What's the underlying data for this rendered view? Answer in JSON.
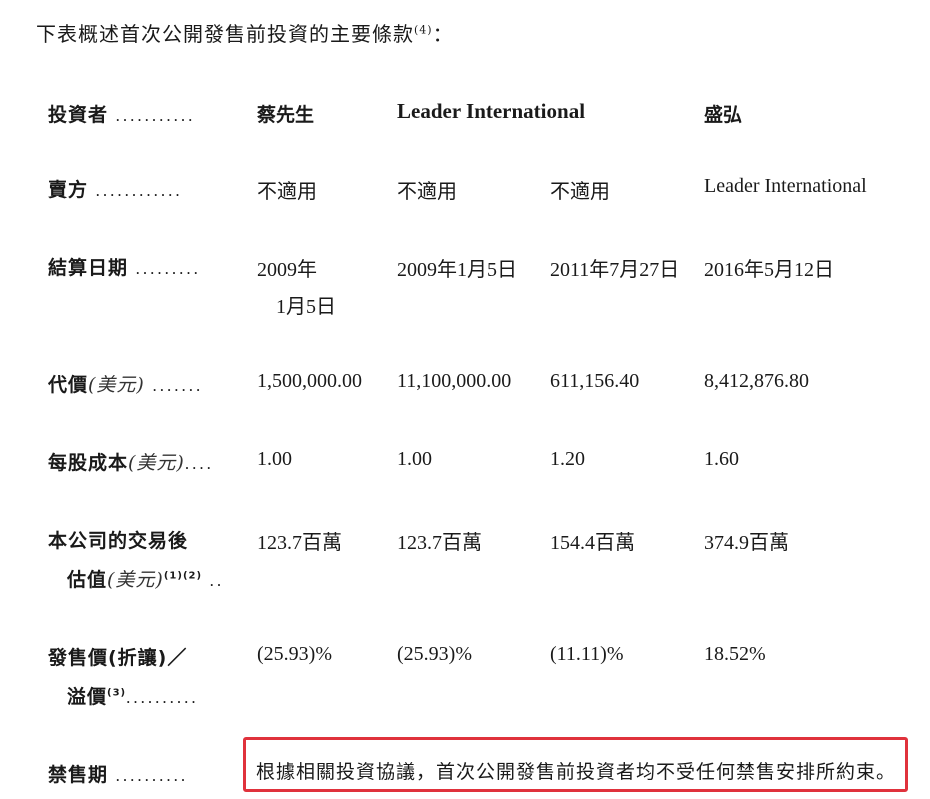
{
  "intro": {
    "text": "下表概述首次公開發售前投資的主要條款",
    "sup": "(4)",
    "tail": "："
  },
  "headers": {
    "investor_label": "投資者",
    "investor_dots": "...........",
    "col1": "蔡先生",
    "col2": "Leader International",
    "col4": "盛弘"
  },
  "rows": {
    "seller": {
      "label": "賣方",
      "dots": "............",
      "c1": "不適用",
      "c2": "不適用",
      "c3": "不適用",
      "c4": "Leader International"
    },
    "settlement": {
      "label": "結算日期",
      "dots": ".........",
      "c1_line1": "2009年",
      "c1_line2": "1月5日",
      "c2": "2009年1月5日",
      "c3": "2011年7月27日",
      "c4": "2016年5月12日"
    },
    "consideration": {
      "label": "代價",
      "unit": "(美元)",
      "dots": ".......",
      "c1": "1,500,000.00",
      "c2": "11,100,000.00",
      "c3": "611,156.40",
      "c4": "8,412,876.80"
    },
    "cost_per_share": {
      "label": "每股成本",
      "unit": "(美元)",
      "dots": "....",
      "c1": "1.00",
      "c2": "1.00",
      "c3": "1.20",
      "c4": "1.60"
    },
    "valuation": {
      "label_line1": "本公司的交易後",
      "label_line2": "估值",
      "unit": "(美元)",
      "sup": "(1)(2)",
      "dots": "..",
      "c1": "123.7百萬",
      "c2": "123.7百萬",
      "c3": "154.4百萬",
      "c4": "374.9百萬"
    },
    "discount": {
      "label_line1": "發售價(折讓)／",
      "label_line2": "溢價",
      "sup": "(3)",
      "dots": "..........",
      "c1": "(25.93)%",
      "c2": "(25.93)%",
      "c3": "(11.11)%",
      "c4": "18.52%"
    },
    "lockup": {
      "label": "禁售期",
      "dots": "..........",
      "text": "根據相關投資協議，首次公開發售前投資者均不受任何禁售安排所約束。"
    }
  },
  "colors": {
    "highlight_border": "#e0323c"
  }
}
